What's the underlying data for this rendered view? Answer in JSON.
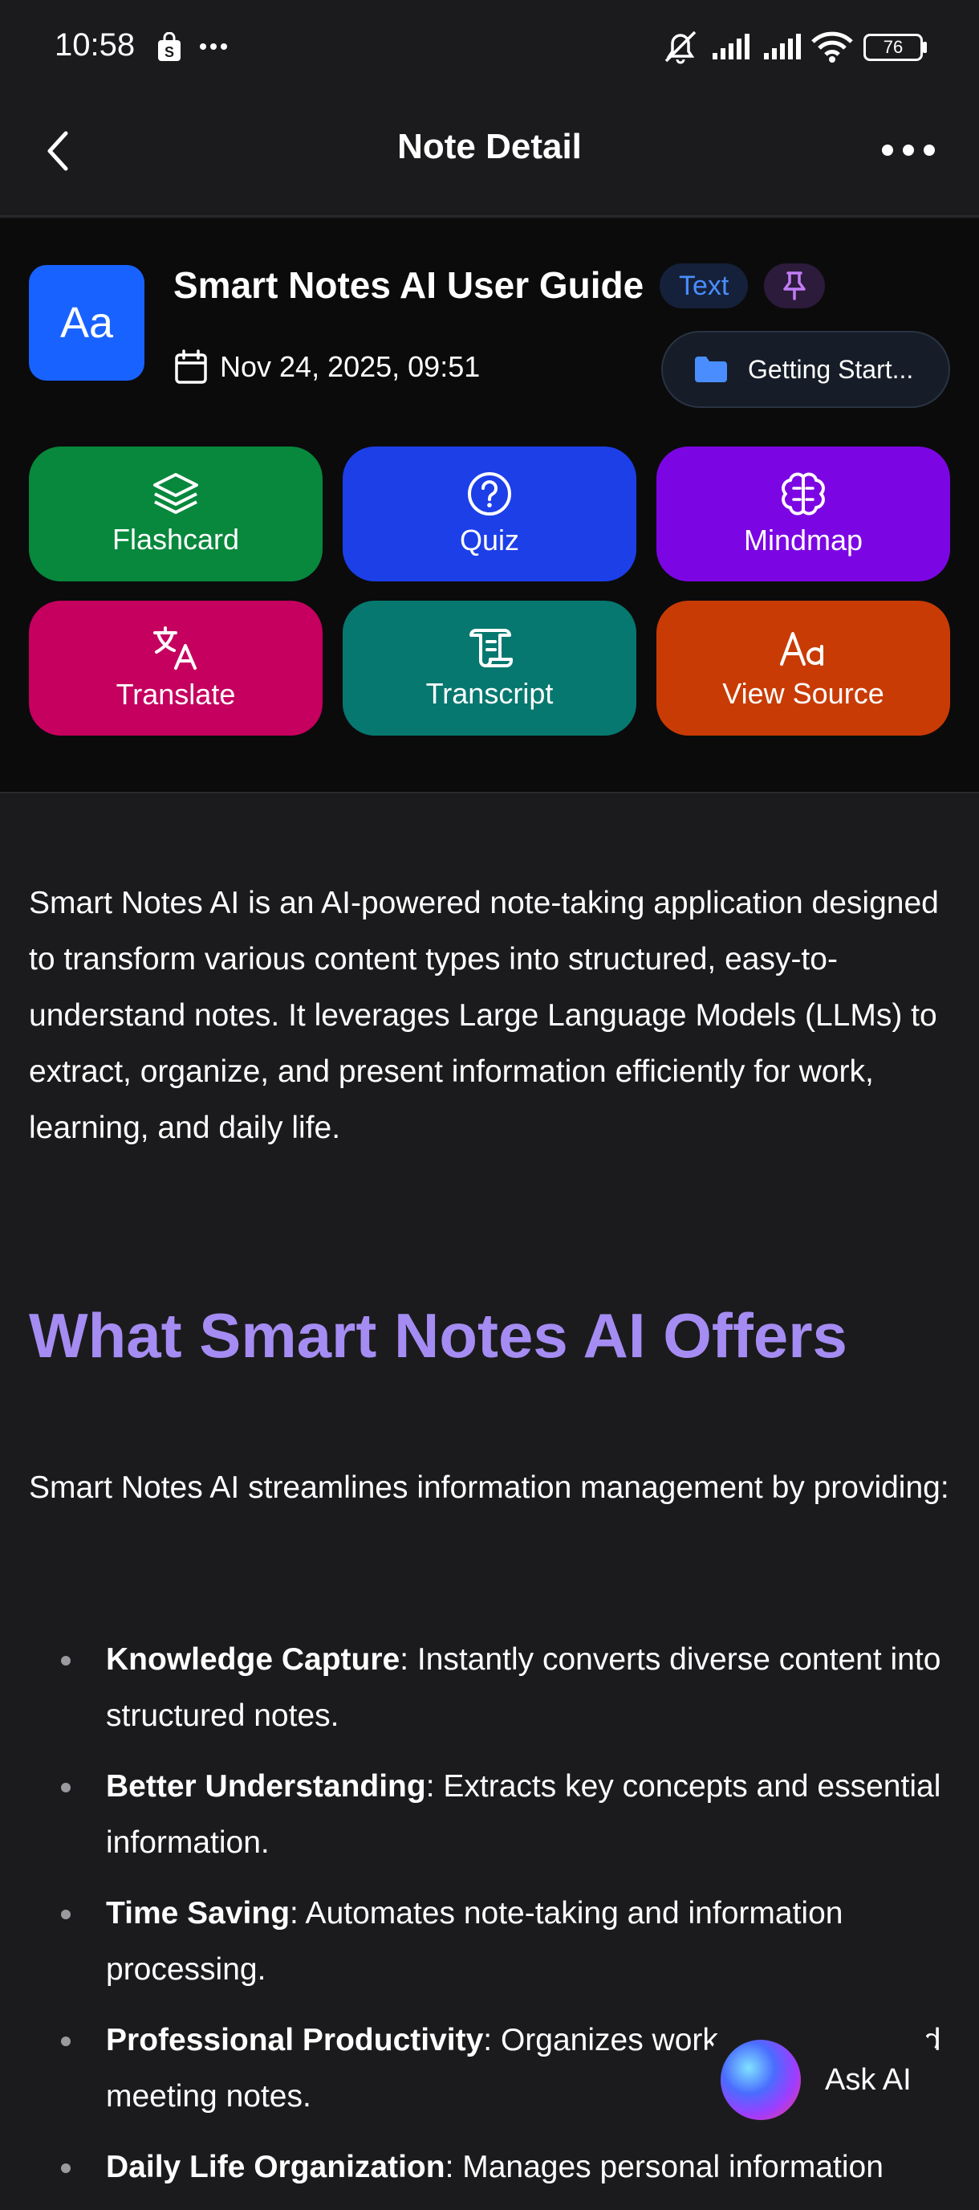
{
  "status_bar": {
    "time": "10:58",
    "icons": [
      "shopping-bag-icon",
      "more-dots-icon",
      "mute-icon",
      "signal-icon",
      "signal-icon",
      "wifi-icon",
      "battery-icon"
    ],
    "battery": "76"
  },
  "app_bar": {
    "title": "Note Detail",
    "back_icon": "chevron-left-icon",
    "more_icon": "more-horizontal-icon"
  },
  "note": {
    "type_tile": "Aa",
    "title": "Smart Notes AI User Guide",
    "type_badge": "Text",
    "pin_icon": "pin-icon",
    "date": "Nov 24, 2025, 09:51",
    "folder": "Getting Start..."
  },
  "tools": [
    {
      "label": "Flashcard",
      "icon": "layers-icon",
      "color": "#07883c"
    },
    {
      "label": "Quiz",
      "icon": "question-circle-icon",
      "color": "#1d3fe8"
    },
    {
      "label": "Mindmap",
      "icon": "brain-icon",
      "color": "#7c06e3"
    },
    {
      "label": "Translate",
      "icon": "translate-icon",
      "color": "#c6005f"
    },
    {
      "label": "Transcript",
      "icon": "scroll-icon",
      "color": "#06786f"
    },
    {
      "label": "View Source",
      "icon": "text-aa-icon",
      "color": "#c93b04"
    }
  ],
  "content": {
    "intro": "Smart Notes AI is an AI-powered note-taking application designed to transform various content types into structured, easy-to-understand notes. It leverages Large Language Models (LLMs) to extract, organize, and present information efficiently for work, learning, and daily life.",
    "heading": "What Smart Notes AI Offers",
    "lead": "Smart Notes AI streamlines information management by providing:",
    "bullets": [
      {
        "term": "Knowledge Capture",
        "text": ": Instantly converts diverse content into structured notes."
      },
      {
        "term": "Better Understanding",
        "text": ": Extracts key concepts and essential information."
      },
      {
        "term": "Time Saving",
        "text": ": Automates note-taking and information processing."
      },
      {
        "term": "Professional Productivity",
        "text": ": Organizes work documents and meeting notes."
      },
      {
        "term": "Daily Life Organization",
        "text": ": Manages personal information"
      }
    ]
  },
  "ask_ai": {
    "label": "Ask AI"
  }
}
